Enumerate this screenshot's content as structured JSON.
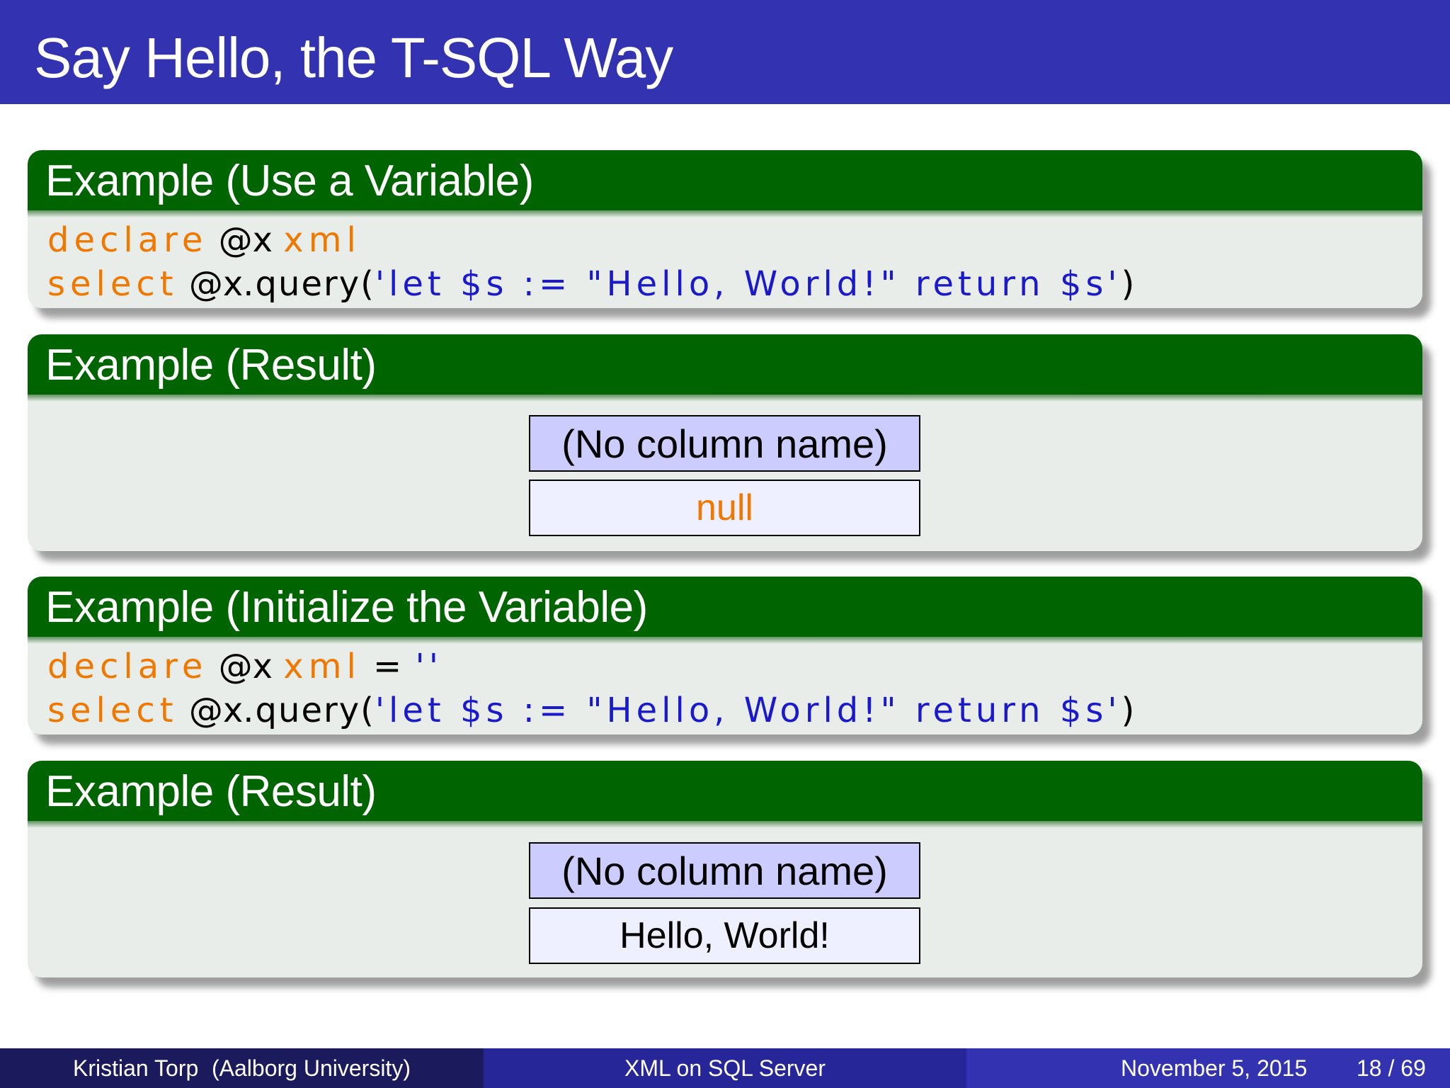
{
  "slide": {
    "title": "Say Hello, the T-SQL Way"
  },
  "blocks": [
    {
      "title": "Example (Use a Variable)",
      "code": [
        [
          {
            "text": "declare",
            "kind": "kw"
          },
          {
            "text": " @x ",
            "kind": "var"
          },
          {
            "text": "xml",
            "kind": "kw"
          }
        ],
        [
          {
            "text": "select",
            "kind": "kw"
          },
          {
            "text": " @x",
            "kind": "var"
          },
          {
            "text": ".query(",
            "kind": "plain"
          },
          {
            "text": "'let $s := \"Hello, World!\" return $s'",
            "kind": "str"
          },
          {
            "text": ")",
            "kind": "plain"
          }
        ]
      ]
    },
    {
      "title": "Example (Result)",
      "column_header": "(No column name)",
      "cell_value": "null",
      "cell_color": "#f07800"
    },
    {
      "title": "Example (Initialize the Variable)",
      "code": [
        [
          {
            "text": "declare",
            "kind": "kw"
          },
          {
            "text": " @x ",
            "kind": "var"
          },
          {
            "text": "xml",
            "kind": "kw"
          },
          {
            "text": " = ",
            "kind": "plain"
          },
          {
            "text": "''",
            "kind": "str"
          }
        ],
        [
          {
            "text": "select",
            "kind": "kw"
          },
          {
            "text": " @x",
            "kind": "var"
          },
          {
            "text": ".query(",
            "kind": "plain"
          },
          {
            "text": "'let $s := \"Hello, World!\" return $s'",
            "kind": "str"
          },
          {
            "text": ")",
            "kind": "plain"
          }
        ]
      ]
    },
    {
      "title": "Example (Result)",
      "column_header": "(No column name)",
      "cell_value": "Hello, World!",
      "cell_color": "#000000"
    }
  ],
  "footer": {
    "author": "Kristian Torp",
    "affiliation": "(Aalborg University)",
    "talk_title": "XML on SQL Server",
    "date": "November 5, 2015",
    "page": "18 / 69"
  },
  "colors": {
    "title_bar": "#3333b2",
    "block_header": "#006400",
    "block_body": "#e9ede9",
    "keyword": "#f07800",
    "string": "#1a1acc",
    "table_header": "#ccccff",
    "table_cell": "#eef0ff"
  }
}
